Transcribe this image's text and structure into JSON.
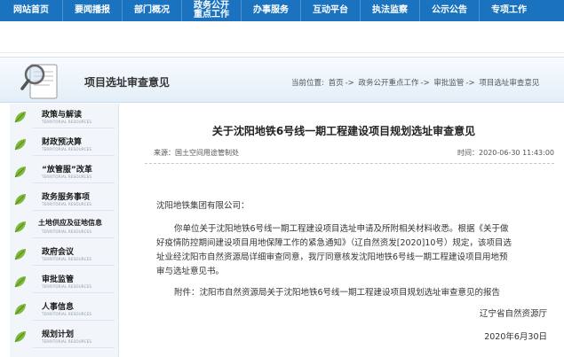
{
  "nav": [
    "网站首页",
    "要闻播报",
    "部门概况",
    "政务公开\n重点工作",
    "办事服务",
    "互动平台",
    "执法监察",
    "公示公告",
    "专项工作"
  ],
  "header": {
    "title": "项目选址审查意见"
  },
  "breadcrumb": {
    "prefix": "当前位置:",
    "items": [
      "首页",
      "政务公开重点工作",
      "审批监管",
      "项目选址审查意见"
    ],
    "separator": "->"
  },
  "sidebar": {
    "subtitle": "TERRITORIAL RESOURCES",
    "items": [
      "政策与解读",
      "财政预决算",
      "“放管服”改革",
      "政务服务事项",
      "土地供应及征地信息",
      "政府会议",
      "审批监管",
      "人事信息",
      "规划计划"
    ]
  },
  "article": {
    "title": "关于沈阳地铁6号线一期工程建设项目规划选址审查意见",
    "source": "来源：国土空间用途管制处",
    "time": "时间：2020-06-30 11:43:00",
    "salutation": "沈阳地铁集团有限公司：",
    "para1_line1": "你单位关于沈阳地铁6号线一期工程建设项目选址申请及所附相关材料收悉。根据《关于做",
    "para1_line2": "好疫情防控期间建设项目用地保障工作的紧急通知》（辽自然资发[2020]10号）规定，该项目选",
    "para1_line3": "址业经沈阳市自然资源局详细审查同意，我厅同意核发沈阳地铁6号线一期工程建设项目用地预",
    "para1_line4": "审与选址意见书。",
    "attachment": "附件：沈阳市自然资源局关于沈阳地铁6号线一期工程建设项目规划选址审查意见的报告",
    "signature": "辽宁省自然资源厅",
    "date": "2020年6月30日"
  }
}
